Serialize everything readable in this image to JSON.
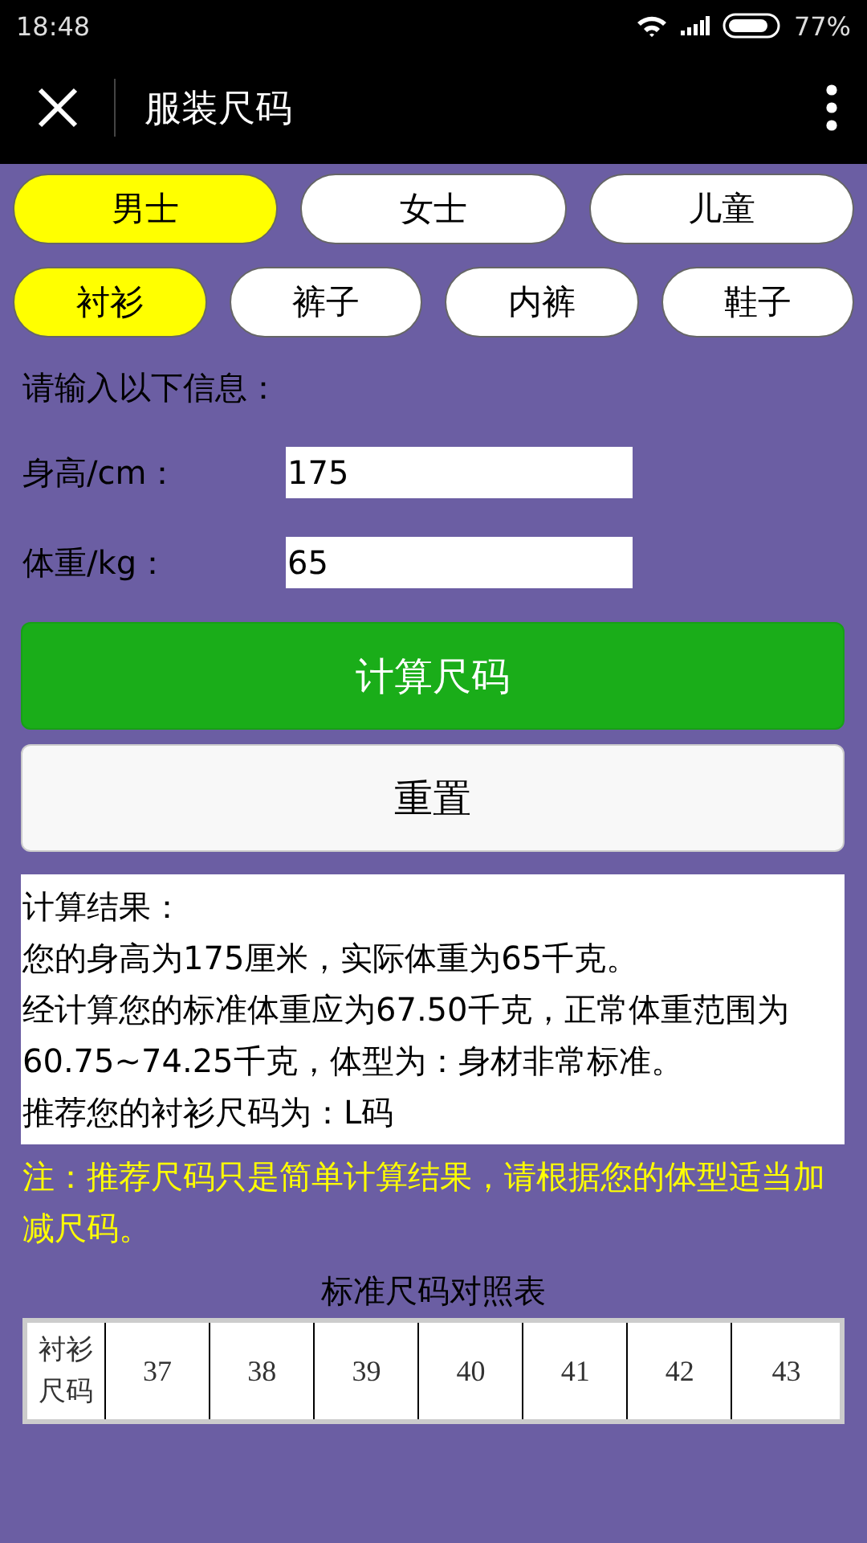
{
  "status_bar": {
    "time": "18:48",
    "battery": "77%"
  },
  "header": {
    "title": "服装尺码"
  },
  "gender_tabs": [
    {
      "label": "男士",
      "selected": true
    },
    {
      "label": "女士",
      "selected": false
    },
    {
      "label": "儿童",
      "selected": false
    }
  ],
  "category_tabs": [
    {
      "label": "衬衫",
      "selected": true
    },
    {
      "label": "裤子",
      "selected": false
    },
    {
      "label": "内裤",
      "selected": false
    },
    {
      "label": "鞋子",
      "selected": false
    }
  ],
  "form": {
    "prompt": "请输入以下信息：",
    "fields": [
      {
        "label": "身高/cm：",
        "value": "175"
      },
      {
        "label": "体重/kg：",
        "value": "65"
      }
    ]
  },
  "buttons": [
    {
      "label": "计算尺码",
      "kind": "primary"
    },
    {
      "label": "重置",
      "kind": "secondary"
    }
  ],
  "result": [
    "计算结果：",
    "您的身高为175厘米，实际体重为65千克。",
    "经计算您的标准体重应为67.50千克，正常体重范围为60.75~74.25千克，体型为：身材非常标准。",
    "推荐您的衬衫尺码为：L码"
  ],
  "note": "注：推荐尺码只是简单计算结果，请根据您的体型适当加减尺码。",
  "size_table": {
    "title": "标准尺码对照表",
    "rows": [
      {
        "header": "衬衫尺码",
        "cells": [
          "37",
          "38",
          "39",
          "40",
          "41",
          "42",
          "43"
        ]
      }
    ]
  }
}
